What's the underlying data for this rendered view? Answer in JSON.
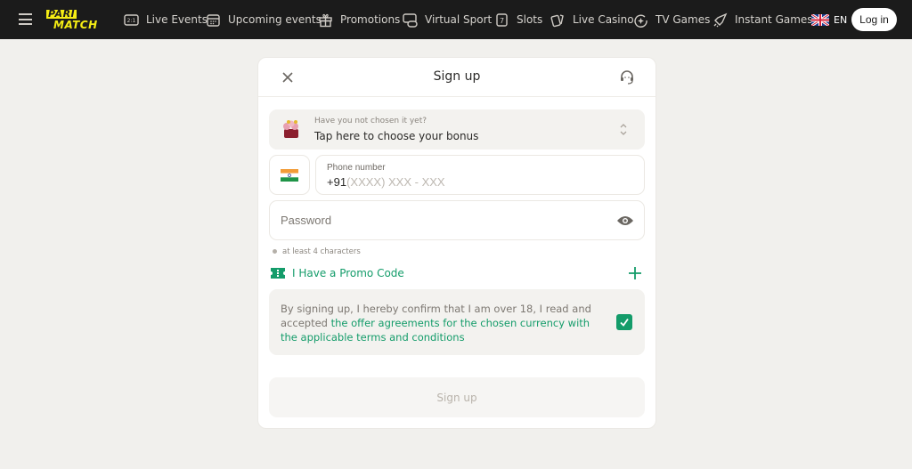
{
  "header": {
    "logo": [
      "PARI",
      "MATCH"
    ],
    "nav": [
      {
        "label": "Live Events",
        "icon": "scoreboard-icon"
      },
      {
        "label": "Upcoming events",
        "icon": "calendar-icon"
      },
      {
        "label": "Promotions",
        "icon": "gift-icon"
      },
      {
        "label": "Virtual Sport",
        "icon": "gamepad-screen-icon"
      },
      {
        "label": "Slots",
        "icon": "slot-seven-icon"
      },
      {
        "label": "Live Casino",
        "icon": "cards-icon"
      },
      {
        "label": "TV Games",
        "icon": "sparkle-circle-icon"
      },
      {
        "label": "Instant Games",
        "icon": "rocket-icon"
      }
    ],
    "language": "EN",
    "login": "Log in"
  },
  "modal": {
    "title": "Sign up",
    "bonus": {
      "hint": "Have you not chosen it yet?",
      "label": "Tap here to choose your bonus"
    },
    "phone": {
      "label": "Phone number",
      "prefix": "+91",
      "placeholder": "(XXXX) XXX - XXX"
    },
    "password": {
      "placeholder": "Password"
    },
    "password_hint": "at least 4 characters",
    "promo": "I Have a Promo Code",
    "agreement": {
      "text": "By signing up, I hereby confirm that I am over 18, I read and accepted ",
      "link": "the offer agreements for the chosen currency with the applicable terms and conditions",
      "checked": true
    },
    "submit": "Sign up"
  },
  "colors": {
    "accent": "#149c6a",
    "logo": "#f5ed14",
    "header": "#1b1b1b"
  }
}
